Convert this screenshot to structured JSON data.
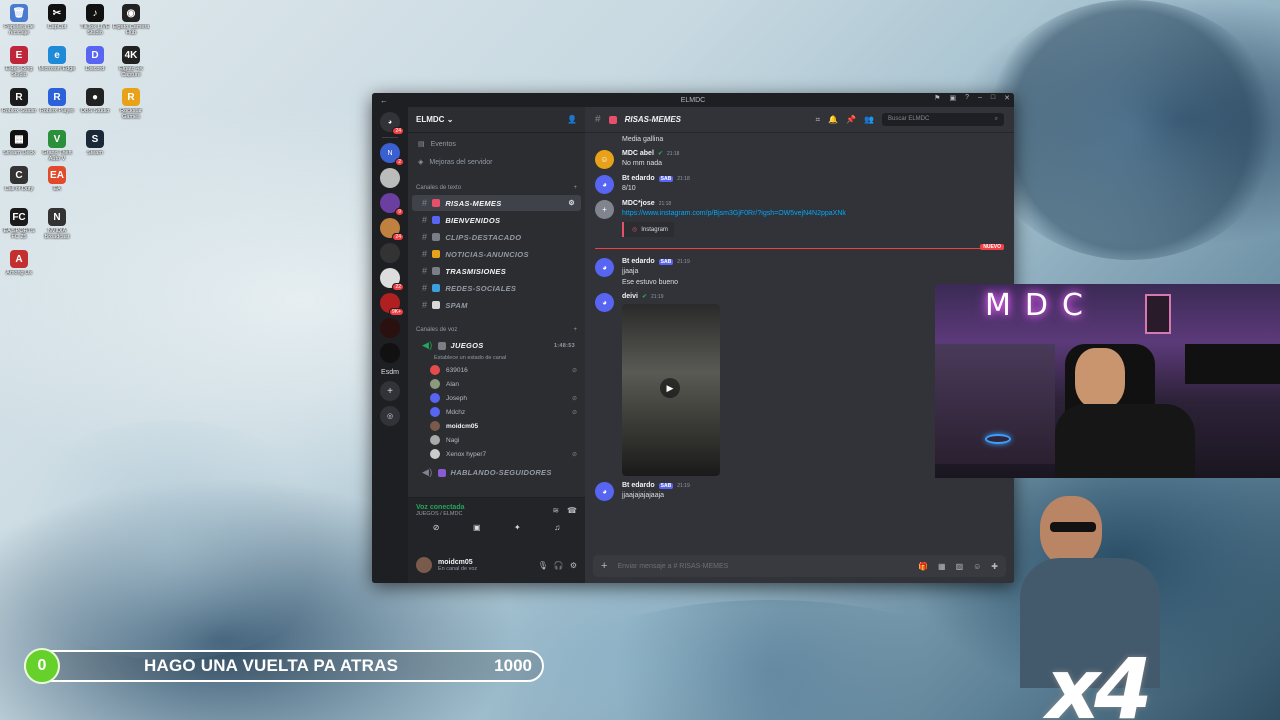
{
  "desktop_icons": [
    {
      "label": "Papelera de reciclaje",
      "color": "#4a7bd1",
      "glyph": "🗑"
    },
    {
      "label": "CapCut",
      "color": "#111",
      "glyph": "✂"
    },
    {
      "label": "TikTok LIVE Studio",
      "color": "#111",
      "glyph": "♪"
    },
    {
      "label": "Elgato Camera Hub",
      "color": "#222",
      "glyph": "◉"
    },
    {
      "label": "Elden Ring Studio",
      "color": "#c0263a",
      "glyph": "E"
    },
    {
      "label": "Microsoft Edge",
      "color": "#1f8ad8",
      "glyph": "e"
    },
    {
      "label": "Discord",
      "color": "#5865f2",
      "glyph": "D"
    },
    {
      "label": "Elgato 4K Capture",
      "color": "#222",
      "glyph": "4K"
    },
    {
      "label": "Roblox Studio",
      "color": "#1b1b1b",
      "glyph": "R"
    },
    {
      "label": "Roblox Player",
      "color": "#2b62d9",
      "glyph": "R"
    },
    {
      "label": "OBS Studio",
      "color": "#222",
      "glyph": "●"
    },
    {
      "label": "Rockstar Games",
      "color": "#e8a21a",
      "glyph": "R"
    },
    {
      "label": "Stream Deck",
      "color": "#111",
      "glyph": "▦"
    },
    {
      "label": "Grand Theft Auto V",
      "color": "#2b8f3b",
      "glyph": "V"
    },
    {
      "label": "Steam",
      "color": "#1b2838",
      "glyph": "S"
    },
    {
      "label": "Call of Duty",
      "color": "#333",
      "glyph": "C"
    },
    {
      "label": "EA",
      "color": "#e14b2b",
      "glyph": "EA"
    },
    {
      "label": "EA SPORTS FC 25",
      "color": "#1b1b1b",
      "glyph": "FC"
    },
    {
      "label": "NVIDIA Broadcast",
      "color": "#333",
      "glyph": "N"
    },
    {
      "label": "Among Us",
      "color": "#c43030",
      "glyph": "A"
    }
  ],
  "window": {
    "title": "ELMDC",
    "server_name": "ELMDC",
    "nav_events": "Eventos",
    "nav_boost": "Mejoras del servidor",
    "text_category": "Canales de texto",
    "voice_category": "Canales de voz",
    "text_channels": [
      {
        "name": "RISAS-MEMES",
        "color": "#e6506a",
        "state": "active"
      },
      {
        "name": "BIENVENIDOS",
        "color": "#5865f2",
        "state": "unread"
      },
      {
        "name": "CLIPS-DESTACADO",
        "color": "#7a7f87",
        "state": "normal"
      },
      {
        "name": "NOTICIAS-ANUNCIOS",
        "color": "#e8a21a",
        "state": "normal"
      },
      {
        "name": "TRASMISIONES",
        "color": "#7a7f87",
        "state": "unread"
      },
      {
        "name": "REDES-SOCIALES",
        "color": "#3aa0e0",
        "state": "normal"
      },
      {
        "name": "SPAM",
        "color": "#d9d9d9",
        "state": "normal"
      }
    ],
    "voice_channel": {
      "name": "JUEGOS",
      "timer": "1:48:53",
      "status": "Establece un estado de canal"
    },
    "voice_users": [
      {
        "name": "639016",
        "color": "#e64b4b",
        "muted": true
      },
      {
        "name": "Alan",
        "color": "#8a9a7a",
        "muted": false
      },
      {
        "name": "Joseph",
        "color": "#5865f2",
        "muted": true
      },
      {
        "name": "Mdchz",
        "color": "#5865f2",
        "muted": true
      },
      {
        "name": "moidcm05",
        "color": "#7a5a4a",
        "muted": false
      },
      {
        "name": "Nagi",
        "color": "#aaa",
        "muted": false
      },
      {
        "name": "Xenox hyper7",
        "color": "#ccc",
        "muted": true
      }
    ],
    "voice_channel_2": "HABLANDO-SEGUIDORES",
    "voice_connected": {
      "status": "Voz conectada",
      "detail": "JUEGOS / ELMDC"
    },
    "user": {
      "name": "moidcm05",
      "status": "En canal de voz"
    },
    "guild_badges": [
      "24",
      "2",
      "9",
      "24",
      "22",
      "9K+"
    ],
    "guild_label": "Esdm",
    "header": {
      "channel": "RISAS-MEMES",
      "search_placeholder": "Buscar ELMDC"
    },
    "new_label": "NUEVO",
    "messages": [
      {
        "author": "",
        "time": "",
        "text": "Media gallina",
        "avatar": "none",
        "color": "#5865f2"
      },
      {
        "author": "MDC abel",
        "time": "21:18",
        "text": "No mm nada",
        "avatar": "orange",
        "color": "#e8a21a",
        "verified": true
      },
      {
        "author": "Bt edardo",
        "time": "21:18",
        "text": "8/10",
        "avatar": "discord",
        "color": "#5865f2",
        "tag": "SAB"
      },
      {
        "author": "MDC*jose",
        "time": "21:18",
        "text": "https://www.instagram.com/p/Bjsm3GjF0Rr/?igsh=OW5vejN4N2ppaXNk",
        "avatar": "grey",
        "color": "#80848e",
        "embed": "Instagram"
      },
      {
        "author": "Bt edardo",
        "time": "21:19",
        "text": "jjaaja",
        "text2": "Ese estuvo bueno",
        "avatar": "discord",
        "color": "#5865f2",
        "tag": "SAB"
      },
      {
        "author": "deivi",
        "time": "21:19",
        "text": "",
        "avatar": "discord",
        "color": "#5865f2",
        "video": true,
        "verified": true
      },
      {
        "author": "Bt edardo",
        "time": "21:19",
        "text": "jjaajajajajaaja",
        "avatar": "discord",
        "color": "#5865f2",
        "tag": "SAB"
      }
    ],
    "composer_placeholder": "Enviar mensaje a # RISAS-MEMES"
  },
  "overlay": {
    "count": "0",
    "text": "HAGO UNA VUELTA PA ATRAS",
    "goal": "1000"
  },
  "webcam": {
    "neon": "MDC"
  },
  "sticker": {
    "text": "x4"
  }
}
